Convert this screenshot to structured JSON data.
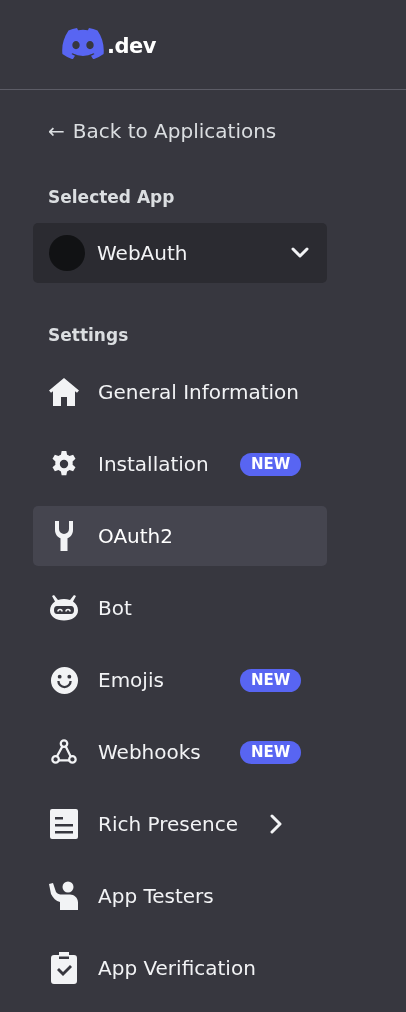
{
  "brand": ".dev",
  "back_link": {
    "arrow": "←",
    "label": "Back to Applications"
  },
  "selected_app": {
    "heading": "Selected App",
    "name": "WebAuth",
    "expanded": false
  },
  "settings": {
    "heading": "Settings",
    "items": [
      {
        "label": "General Information",
        "selected": false,
        "submenu": false
      },
      {
        "label": "Installation",
        "selected": false,
        "badge": "NEW",
        "submenu": false
      },
      {
        "label": "OAuth2",
        "selected": true,
        "submenu": false
      },
      {
        "label": "Bot",
        "selected": false,
        "submenu": false
      },
      {
        "label": "Emojis",
        "selected": false,
        "badge": "NEW",
        "submenu": false
      },
      {
        "label": "Webhooks",
        "selected": false,
        "badge": "NEW",
        "submenu": false
      },
      {
        "label": "Rich Presence",
        "selected": false,
        "submenu": true
      },
      {
        "label": "App Testers",
        "selected": false,
        "submenu": false
      },
      {
        "label": "App Verification",
        "selected": false,
        "submenu": false
      }
    ]
  }
}
